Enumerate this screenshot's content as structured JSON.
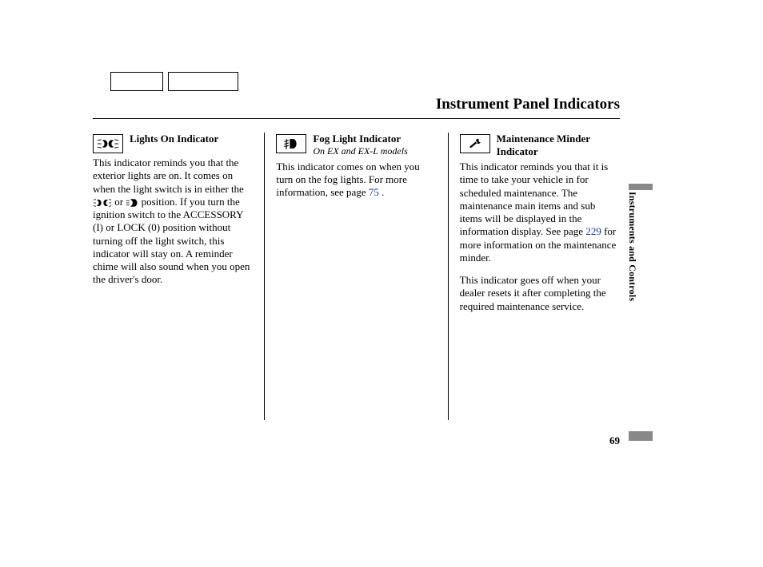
{
  "page": {
    "title": "Instrument Panel Indicators",
    "side_label": "Instruments and Controls",
    "number": "69"
  },
  "col1": {
    "title": "Lights On Indicator",
    "body_a": "This indicator reminds you that the exterior lights are on. It comes on when the light switch is in either the ",
    "body_b": " or ",
    "body_c": " position. If you turn the ignition switch to the ACCESSORY (I) or LOCK (0) position without turning off the light switch, this indicator will stay on. A reminder chime will also sound when you open the driver's door."
  },
  "col2": {
    "title": "Fog Light Indicator",
    "subtitle": "On EX and EX-L models",
    "body_a": "This indicator comes on when you turn on the fog lights. For more information, see page ",
    "page_ref": "75",
    "body_b": " ."
  },
  "col3": {
    "title": "Maintenance Minder Indicator",
    "p1_a": "This indicator reminds you that it is time to take your vehicle in for scheduled maintenance. The maintenance main items and sub items will be displayed in the information display. See page ",
    "p1_ref": "229",
    "p1_b": " for more information on the maintenance minder.",
    "p2": "This indicator goes off when your dealer resets it after completing the required maintenance service."
  }
}
